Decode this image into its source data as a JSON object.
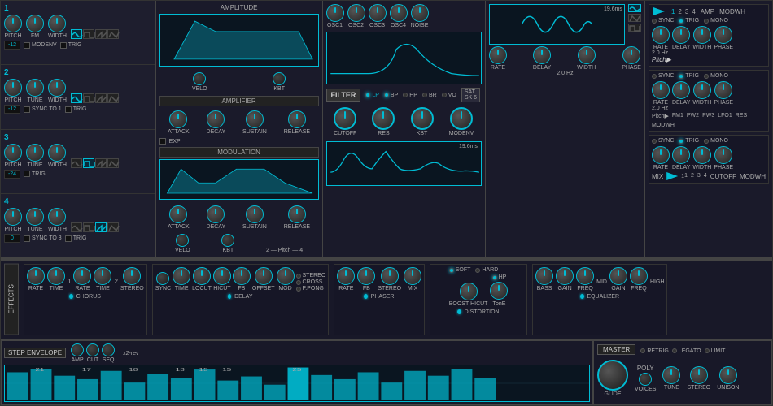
{
  "osc": {
    "sections": [
      {
        "num": "1",
        "pitch_label": "PITCH",
        "fm_label": "FM",
        "width_label": "WIDTH",
        "pitch_val": "-12",
        "checkboxes": [
          "MODENV",
          "TRIG"
        ]
      },
      {
        "num": "2",
        "pitch_label": "PITCH",
        "tune_label": "TUNE",
        "width_label": "WIDTH",
        "pitch_val": "-12",
        "checkboxes": [
          "SYNC TO 1",
          "TRIG"
        ]
      },
      {
        "num": "3",
        "pitch_label": "PITCH",
        "tune_label": "TUNE",
        "width_label": "WIDTH",
        "pitch_val": "-24",
        "checkboxes": [
          "TRIG"
        ]
      },
      {
        "num": "4",
        "pitch_label": "PITCH",
        "tune_label": "TUNE",
        "width_label": "WIDTH",
        "pitch_val": "0",
        "checkboxes": [
          "SYNC TO 3",
          "TRIG"
        ]
      }
    ]
  },
  "amplifier": {
    "label": "AMPLIFIER",
    "mod_label": "MODULATION",
    "knobs1": [
      "ATTACK",
      "DECAY",
      "SUSTAIN",
      "RELEASE"
    ],
    "knobs2": [
      "ATTACK",
      "DECAY",
      "SUSTAIN",
      "RELEASE"
    ],
    "knobs_velo_kbt": [
      "VELO",
      "KBT"
    ],
    "exp_label": "EXP"
  },
  "osc_section": {
    "labels": [
      "OSC1",
      "OSC2",
      "OSC3",
      "OSC4",
      "NOISE"
    ]
  },
  "filter": {
    "label": "FILTER",
    "types": [
      "LP",
      "BP",
      "HP",
      "BR",
      "VO"
    ],
    "sat_label": "SAT",
    "sk6_label": "SK 6",
    "knobs": [
      "CUTOFF",
      "RES",
      "KBT",
      "MODENV"
    ],
    "cutoff_text": "CUTOFF"
  },
  "lfo": {
    "sections": [
      {
        "num": "1",
        "pitch_label": "Pitch",
        "time_display": "19.6ms",
        "knobs": [
          "RATE",
          "DELAY",
          "WIDTH",
          "PHASE"
        ],
        "rate_val": "2.0 Hz",
        "tabs": [
          "1",
          "2",
          "3",
          "4"
        ],
        "amp_label": "AMP",
        "modwh_label": "MODWH",
        "sync": "SYNC",
        "trig": "TRIG",
        "mono": "MONO"
      },
      {
        "num": "2",
        "pitch_label": "Pitch",
        "time_display": "19.6ms",
        "knobs": [
          "RATE",
          "DELAY",
          "WIDTH",
          "PHASE"
        ],
        "rate_val": "2.0 Hz",
        "tabs": [
          "FM1",
          "PW2",
          "PW3",
          "LFO1",
          "RES",
          "MODWH"
        ],
        "sync": "SYNC",
        "trig": "TRIG",
        "mono": "MONO"
      },
      {
        "num": "3",
        "pitch_label": "MIX",
        "time_display": "19.6ms",
        "knobs": [
          "RATE",
          "DELAY",
          "WIDTH",
          "PHASE"
        ],
        "rate_val": "1",
        "tabs": [
          "1",
          "2",
          "3",
          "4"
        ],
        "cutoff_label": "CUTOFF",
        "modwh_label": "MODWH",
        "sync": "SYNC",
        "trig": "TRIG",
        "mono": "MONO"
      }
    ]
  },
  "effects": {
    "label": "EFFECTS",
    "chorus": {
      "label": "CHORUS",
      "knobs": [
        "RATE",
        "TIME",
        "RATE",
        "TIME",
        "STEREO"
      ],
      "nums": [
        "1",
        "2"
      ]
    },
    "delay": {
      "label": "DELAY",
      "knobs": [
        "SYNC",
        "TIME",
        "LOCUT",
        "HICUT",
        "FB",
        "OFFSET",
        "MOD"
      ],
      "stereo_opts": [
        "STEREO",
        "CROSS",
        "P.PONG"
      ]
    },
    "phaser": {
      "label": "PHASER",
      "knobs": [
        "RATE",
        "FB",
        "STEREO"
      ],
      "mix_label": "MIX"
    },
    "distortion": {
      "label": "DISTORTION",
      "soft": "SOFT",
      "hard": "HARD",
      "boost_label": "BOOST HICUT",
      "hp_label": "HP",
      "tone_label": "TonE"
    },
    "equalizer": {
      "label": "EQUALIZER",
      "knobs": [
        "BASS",
        "GAIN",
        "FREQ",
        "GAIN",
        "FREQ"
      ],
      "labels": [
        "MID",
        "HIGH"
      ]
    }
  },
  "step_env": {
    "label": "STEP ENVELOPE",
    "x2rev_label": "x2-rev",
    "bar_nums": [
      "21",
      "17",
      "18",
      "13",
      "15",
      "15",
      "25"
    ],
    "knob_labels": [
      "AMP",
      "CUT",
      "SEQ"
    ]
  },
  "master": {
    "label": "MASTER",
    "checkboxes": [
      "RETRIG",
      "LEGATO",
      "LIMIT"
    ],
    "knob_labels": [
      "GLIDE",
      "VOICES",
      "TUNE",
      "STEREO",
      "UNISON"
    ],
    "poly_label": "POLY"
  },
  "colors": {
    "accent": "#00bcd4",
    "background": "#1a1a2e",
    "panel": "#1e1e2e",
    "display": "#0a1520",
    "border": "#444"
  }
}
